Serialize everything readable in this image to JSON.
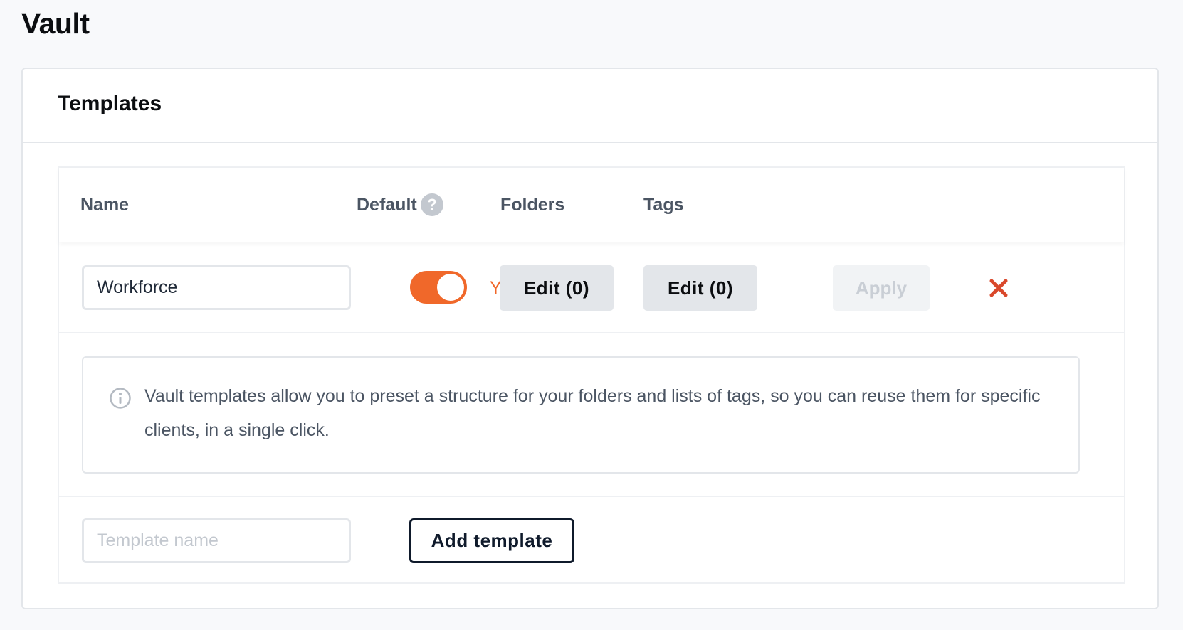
{
  "page": {
    "title": "Vault"
  },
  "panel": {
    "title": "Templates"
  },
  "table": {
    "columns": {
      "name": "Name",
      "default": "Default",
      "folders": "Folders",
      "tags": "Tags"
    },
    "help_icon": "question-icon",
    "rows": [
      {
        "name": "Workforce",
        "default_on": true,
        "default_label": "Yes",
        "folders_button": "Edit (0)",
        "tags_button": "Edit (0)",
        "apply_button": "Apply",
        "delete_icon": "close-icon"
      }
    ]
  },
  "info": {
    "icon": "info-icon",
    "text": "Vault templates allow you to preset a structure for your folders and lists of tags, so you can reuse them for specific clients, in a single click."
  },
  "add": {
    "placeholder": "Template name",
    "value": "",
    "button": "Add template"
  },
  "colors": {
    "accent": "#f0682a",
    "delete": "#d9482b",
    "dark": "#0f1a2b"
  }
}
